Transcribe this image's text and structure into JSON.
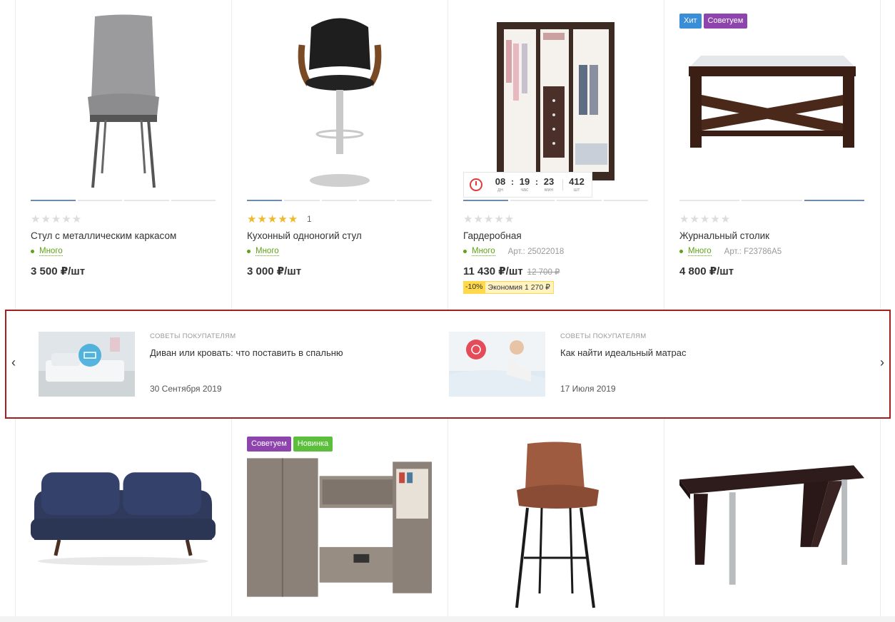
{
  "top_row": [
    {
      "badges": [],
      "rating": {
        "filled": 0,
        "stars": "★★★★★",
        "count": ""
      },
      "title": "Стул с металлическим каркасом",
      "stock": "Много",
      "article": "",
      "price": "3 500 ₽/шт",
      "old_price": "",
      "image": "chair-image"
    },
    {
      "badges": [],
      "rating": {
        "filled": 5,
        "stars": "★★★★★",
        "count": "1"
      },
      "title": "Кухонный одноногий стул",
      "stock": "Много",
      "article": "",
      "price": "3 000 ₽/шт",
      "old_price": "",
      "image": "bar-stool-image"
    },
    {
      "badges": [],
      "rating": {
        "filled": 0,
        "stars": "★★★★★",
        "count": ""
      },
      "title": "Гардеробная",
      "stock": "Много",
      "article": "Арт.: 25022018",
      "price": "11 430 ₽/шт",
      "old_price": "12 700 ₽",
      "discount": {
        "percent": "-10%",
        "saving": "Экономия 1 270 ₽"
      },
      "timer": {
        "days": "08",
        "days_label": "дн",
        "hours": "19",
        "hours_label": "час",
        "minutes": "23",
        "minutes_label": "мин",
        "qty": "412",
        "qty_label": "шт"
      },
      "image": "wardrobe-image"
    },
    {
      "badges": [
        {
          "label": "Хит",
          "color": "#3a8ed7"
        },
        {
          "label": "Советуем",
          "color": "#8e44ad"
        }
      ],
      "rating": {
        "filled": 0,
        "stars": "★★★★★",
        "count": ""
      },
      "title": "Журнальный столик",
      "stock": "Много",
      "article": "Арт.: F23786A5",
      "price": "4 800 ₽/шт",
      "old_price": "",
      "image": "coffee-table-image"
    }
  ],
  "blog": {
    "prev_icon": "‹",
    "next_icon": "›",
    "articles": [
      {
        "category": "СОВЕТЫ ПОКУПАТЕЛЯМ",
        "title": "Диван или кровать: что поставить в спальню",
        "date": "30 Сентября 2019"
      },
      {
        "category": "СОВЕТЫ ПОКУПАТЕЛЯМ",
        "title": "Как найти идеальный матрас",
        "date": "17 Июля 2019"
      }
    ]
  },
  "bottom_row": [
    {
      "badges": [],
      "image": "sofa-image"
    },
    {
      "badges": [
        {
          "label": "Советуем",
          "color": "#8e44ad"
        },
        {
          "label": "Новинка",
          "color": "#5bbf3c"
        }
      ],
      "image": "wall-unit-image"
    },
    {
      "badges": [],
      "image": "bar-chair-image"
    },
    {
      "badges": [],
      "image": "desk-image"
    }
  ],
  "colors": {
    "stock_green": "#5fa314",
    "star_gold": "#f0b929",
    "blog_border": "#a51d1d",
    "timer_red": "#e03b3b"
  }
}
